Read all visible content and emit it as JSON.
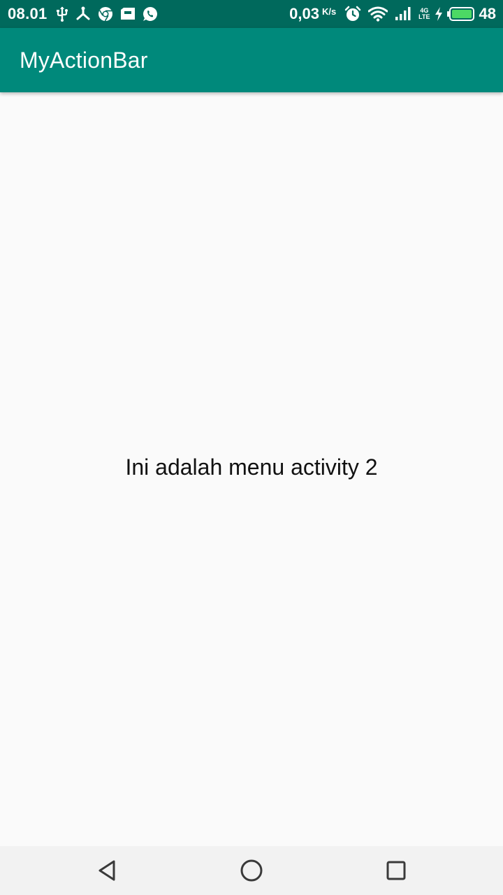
{
  "status_bar": {
    "time": "08.01",
    "left_icons": [
      "usb-icon",
      "share-icon",
      "chrome-icon",
      "sd-card-icon",
      "whatsapp-icon"
    ],
    "network_speed": "0,03",
    "network_speed_unit": "K/s",
    "network_type_top": "4G",
    "network_type_bottom": "LTE",
    "right_icons": [
      "alarm-icon",
      "wifi-icon",
      "signal-icon",
      "network-type-icon",
      "charging-icon",
      "battery-icon"
    ],
    "battery_level": "48",
    "colors": {
      "background": "#00695c",
      "battery_fill": "#4cd964"
    }
  },
  "app_bar": {
    "title": "MyActionBar",
    "color": "#00897b"
  },
  "content": {
    "message": "Ini adalah menu activity 2"
  },
  "nav_bar": {
    "buttons": [
      "back-icon",
      "home-icon",
      "recents-icon"
    ]
  }
}
